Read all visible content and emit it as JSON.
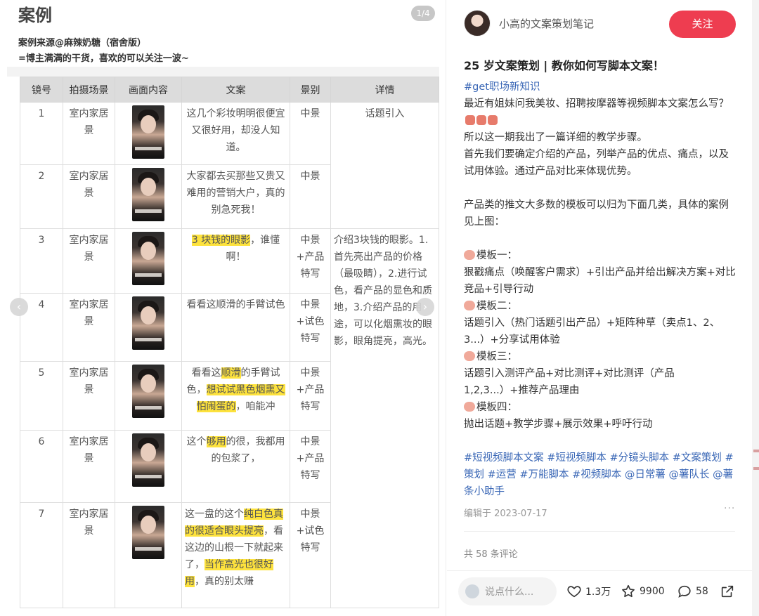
{
  "left": {
    "title": "案例",
    "counter": "1/4",
    "source": "案例来源@麻辣奶糖（宿舍版）",
    "note": "=博主满满的干货，喜欢的可以关注一波~",
    "headers": [
      "镜号",
      "拍摄场景",
      "画面内容",
      "文案",
      "景别",
      "详情"
    ],
    "rows": [
      {
        "num": "1",
        "scene": "室内家居景",
        "copy_a": "这几个彩妆明明很便宜又很好用，却没人知道。",
        "shot": "中景"
      },
      {
        "num": "2",
        "scene": "室内家居景",
        "copy_a": "大家都去买那些又贵又难用的营销大户，真的别急死我！",
        "shot": "中景"
      },
      {
        "num": "3",
        "scene": "室内家居景",
        "copy_hl": "3 块钱的眼影",
        "copy_b": "，谁懂啊！",
        "shot": "中景+产品特写"
      },
      {
        "num": "4",
        "scene": "室内家居景",
        "copy_a": "看看这顺滑的手臂试色",
        "shot": "中景+试色特写"
      },
      {
        "num": "5",
        "scene": "室内家居景",
        "copy_a": "看看这",
        "copy_hl": "顺滑",
        "copy_b": "的手臂试色，",
        "copy_hl2": "想试试黑色烟熏又怕闹蛋的",
        "copy_c": "，咱能冲",
        "shot": "中景+产品特写"
      },
      {
        "num": "6",
        "scene": "室内家居景",
        "copy_a": "这个",
        "copy_hl": "够用",
        "copy_b": "的很，我都用的包浆了，",
        "shot": "中景+产品特写"
      },
      {
        "num": "7",
        "scene": "室内家居景",
        "copy_a": "这一盘的这个",
        "copy_hl": "纯白色真的很适合眼头提亮",
        "copy_b": "，看这边的山根一下就起来了，",
        "copy_hl2": "当作高光也很好用",
        "copy_c": "，真的别太赚",
        "shot": "中景+试色特写"
      }
    ],
    "detail_1": "话题引入",
    "detail_2": "介绍3块钱的眼影。1.首先亮出产品的价格（最吸睛），2.进行试色，看产品的显色和质地，3.介绍产品的用途，可以化烟熏妆的眼影，眼角提亮，高光。"
  },
  "author": {
    "name": "小高的文案策划笔记",
    "follow": "关注"
  },
  "note": {
    "title": "25 岁文案策划 | 教你如何写脚本文案！",
    "hashtag1": "#get职场新知识",
    "p1": "最近有姐妹问我美妆、招聘按摩器等视频脚本文案怎么写？",
    "p2": "所以这一期我出了一篇详细的教学步骤。",
    "p3": "首先我们要确定介绍的产品，列举产品的优点、痛点，以及试用体验。通过产品对比来体现优势。",
    "p4": "产品类的推文大多数的模板可以归为下面几类，具体的案例见上图：",
    "t1": "模板一：",
    "t1b": "狠戳痛点（唤醒客户需求）+引出产品并给出解决方案+对比竞品+引导行动",
    "t2": "模板二：",
    "t2b": "话题引入（热门话题引出产品）+矩阵种草（卖点1、2、3...）+分享试用体验",
    "t3": "模板三：",
    "t3b": "话题引入测评产品+对比测评+对比测评（产品1,2,3...）+推荐产品理由",
    "t4": "模板四：",
    "t4b": "抛出话题+教学步骤+展示效果+呼吁行动",
    "tags": "#短视频脚本文案 #短视频脚本 #分镜头脚本 #文案策划 #策划 #运营 #万能脚本 #视频脚本 @日常薯 @薯队长 @薯条小助手",
    "edited": "编辑于 2023-07-17",
    "more": "···",
    "comments": "共 58 条评论"
  },
  "footer": {
    "placeholder": "说点什么...",
    "likes": "1.3万",
    "stars": "9900",
    "comments": "58"
  },
  "colors": {
    "follow": "#ee3d50",
    "tag": "#3a67b6",
    "highlight": "#fde23d"
  }
}
